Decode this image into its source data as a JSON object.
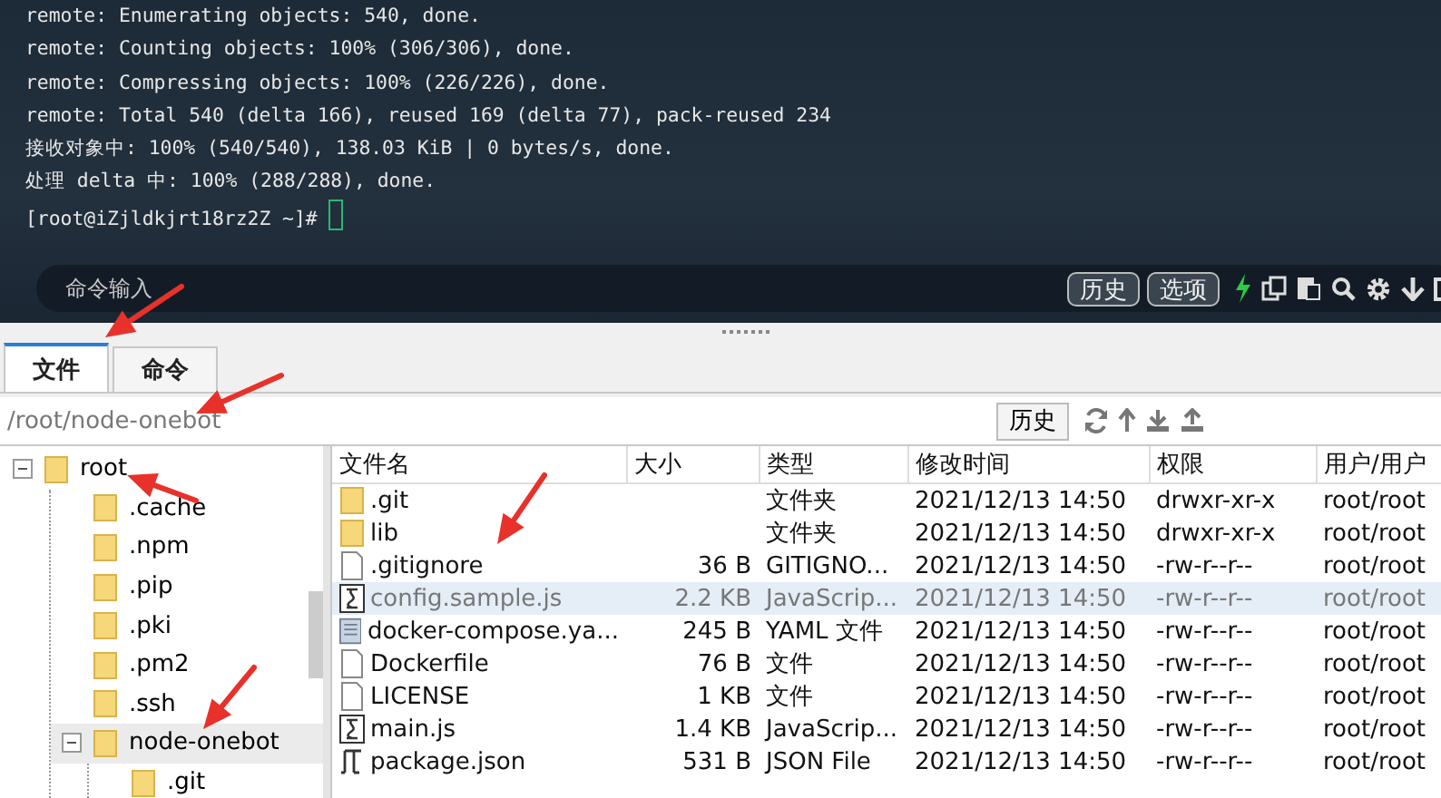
{
  "terminal": {
    "lines": [
      "remote: Enumerating objects: 540, done.",
      "remote: Counting objects: 100% (306/306), done.",
      "remote: Compressing objects: 100% (226/226), done.",
      "remote: Total 540 (delta 166), reused 169 (delta 77), pack-reused 234",
      "接收对象中: 100% (540/540), 138.03 KiB | 0 bytes/s, done.",
      "处理 delta 中: 100% (288/288), done.",
      "[root@iZjldkjrt18rz2Z ~]#"
    ]
  },
  "command_bar": {
    "placeholder": "命令输入",
    "buttons": [
      "历史",
      "选项"
    ]
  },
  "tabs": [
    {
      "label": "文件",
      "selected": true
    },
    {
      "label": "命令",
      "selected": false
    }
  ],
  "path_bar": {
    "path": "/root/node-onebot",
    "history_button": "历史"
  },
  "tree": [
    {
      "name": "root",
      "expanded": true,
      "selected": false,
      "children": [
        {
          "name": ".cache",
          "selected": false
        },
        {
          "name": ".npm",
          "selected": false
        },
        {
          "name": ".pip",
          "selected": false
        },
        {
          "name": ".pki",
          "selected": false
        },
        {
          "name": ".pm2",
          "selected": false
        },
        {
          "name": ".ssh",
          "selected": false
        },
        {
          "name": "node-onebot",
          "expanded": true,
          "selected": true,
          "children": [
            {
              "name": ".git",
              "selected": false
            }
          ]
        }
      ]
    }
  ],
  "table": {
    "columns": [
      "文件名",
      "大小",
      "类型",
      "修改时间",
      "权限",
      "用户/用户"
    ],
    "rows": [
      {
        "kind": "folder",
        "name": ".git",
        "size": "",
        "type": "文件夹",
        "modified": "2021/12/13 14:50",
        "permissions": "drwxr-xr-x",
        "owner": "root/root",
        "selected": false
      },
      {
        "kind": "folder",
        "name": "lib",
        "size": "",
        "type": "文件夹",
        "modified": "2021/12/13 14:50",
        "permissions": "drwxr-xr-x",
        "owner": "root/root",
        "selected": false
      },
      {
        "kind": "file",
        "name": ".gitignore",
        "size": "36 B",
        "type": "GITIGNO...",
        "modified": "2021/12/13 14:50",
        "permissions": "-rw-r--r--",
        "owner": "root/root",
        "selected": false
      },
      {
        "kind": "script",
        "name": "config.sample.js",
        "size": "2.2 KB",
        "type": "JavaScrip...",
        "modified": "2021/12/13 14:50",
        "permissions": "-rw-r--r--",
        "owner": "root/root",
        "selected": true
      },
      {
        "kind": "yaml",
        "name": "docker-compose.ya...",
        "size": "245 B",
        "type": "YAML 文件",
        "modified": "2021/12/13 14:50",
        "permissions": "-rw-r--r--",
        "owner": "root/root",
        "selected": false
      },
      {
        "kind": "file",
        "name": "Dockerfile",
        "size": "76 B",
        "type": "文件",
        "modified": "2021/12/13 14:50",
        "permissions": "-rw-r--r--",
        "owner": "root/root",
        "selected": false
      },
      {
        "kind": "file",
        "name": "LICENSE",
        "size": "1 KB",
        "type": "文件",
        "modified": "2021/12/13 14:50",
        "permissions": "-rw-r--r--",
        "owner": "root/root",
        "selected": false
      },
      {
        "kind": "script",
        "name": "main.js",
        "size": "1.4 KB",
        "type": "JavaScrip...",
        "modified": "2021/12/13 14:50",
        "permissions": "-rw-r--r--",
        "owner": "root/root",
        "selected": false
      },
      {
        "kind": "json",
        "name": "package.json",
        "size": "531 B",
        "type": "JSON File",
        "modified": "2021/12/13 14:50",
        "permissions": "-rw-r--r--",
        "owner": "root/root",
        "selected": false
      }
    ]
  }
}
